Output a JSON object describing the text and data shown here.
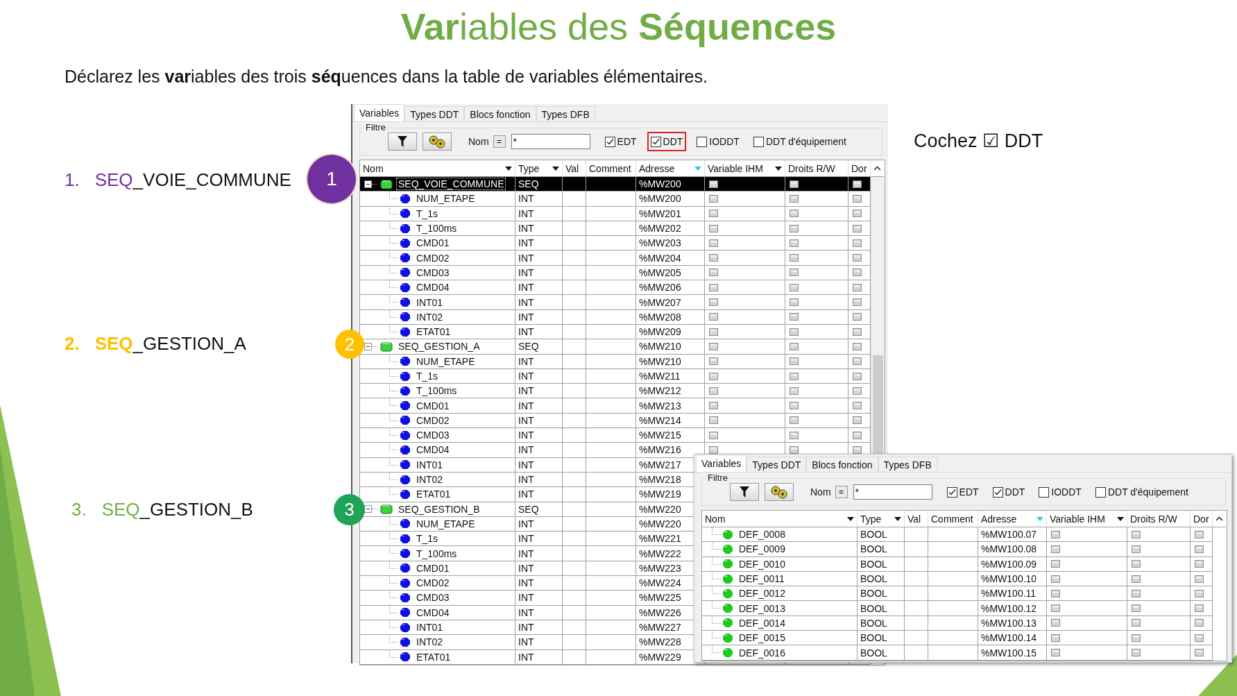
{
  "slide": {
    "title": "**Var**iables des **Séquences**",
    "instruction": "Déclarez les **var**iables des trois **séq**uences dans la table de variables élémentaires.",
    "hint": "Cochez ☑ DDT",
    "sequences": [
      {
        "number": "1.",
        "prefix": "SEQ",
        "rest": "_VOIE_COMMUNE",
        "color": "#7030a0",
        "badge": {
          "label": "1",
          "color": "#7030a0"
        }
      },
      {
        "number": "2.",
        "prefix": "SEQ",
        "rest": "_GESTION_A",
        "color": "#ffc000",
        "badge": {
          "label": "2",
          "color": "#ffc000"
        }
      },
      {
        "number": "3.",
        "prefix": "SEQ",
        "rest": "_GESTION_B",
        "color": "#70ad47",
        "badge": {
          "label": "3",
          "color": "#1ea456"
        }
      }
    ]
  },
  "windows": [
    {
      "tabs": [
        {
          "label": "Variables",
          "selected": true
        },
        {
          "label": "Types DDT",
          "selected": false
        },
        {
          "label": "Blocs fonction",
          "selected": false
        },
        {
          "label": "Types DFB",
          "selected": false
        }
      ],
      "filter": {
        "legend": "Filtre",
        "name_label": "Nom",
        "operator": "=",
        "value": "*",
        "options": [
          {
            "label": "EDT",
            "checked": true,
            "highlighted": false
          },
          {
            "label": "DDT",
            "checked": true,
            "highlighted": true
          },
          {
            "label": "IODDT",
            "checked": false,
            "highlighted": false
          },
          {
            "label": "DDT d'équipement",
            "checked": false,
            "highlighted": false
          }
        ]
      },
      "columns": [
        {
          "label": "Nom",
          "menu": true,
          "sorted": false
        },
        {
          "label": "Type",
          "menu": true,
          "sorted": false
        },
        {
          "label": "Val",
          "menu": false,
          "sorted": false
        },
        {
          "label": "Comment",
          "menu": false,
          "sorted": false
        },
        {
          "label": "Adresse",
          "menu": false,
          "sorted": true
        },
        {
          "label": "Variable IHM",
          "menu": true,
          "sorted": false
        },
        {
          "label": "Droits R/W",
          "menu": false,
          "sorted": false
        },
        {
          "label": "Dor",
          "menu": false,
          "sorted": false
        }
      ],
      "rows": [
        {
          "name": "SEQ_VOIE_COMMUNE",
          "type": "SEQ",
          "address": "%MW200",
          "kind": "sequence",
          "expanded": true,
          "selected": true,
          "children": [
            {
              "name": "NUM_ETAPE",
              "type": "INT",
              "address": "%MW200",
              "kind": "int",
              "selected": false
            },
            {
              "name": "T_1s",
              "type": "INT",
              "address": "%MW201",
              "kind": "int",
              "selected": false
            },
            {
              "name": "T_100ms",
              "type": "INT",
              "address": "%MW202",
              "kind": "int",
              "selected": false
            },
            {
              "name": "CMD01",
              "type": "INT",
              "address": "%MW203",
              "kind": "int",
              "selected": false
            },
            {
              "name": "CMD02",
              "type": "INT",
              "address": "%MW204",
              "kind": "int",
              "selected": false
            },
            {
              "name": "CMD03",
              "type": "INT",
              "address": "%MW205",
              "kind": "int",
              "selected": false
            },
            {
              "name": "CMD04",
              "type": "INT",
              "address": "%MW206",
              "kind": "int",
              "selected": false
            },
            {
              "name": "INT01",
              "type": "INT",
              "address": "%MW207",
              "kind": "int",
              "selected": false
            },
            {
              "name": "INT02",
              "type": "INT",
              "address": "%MW208",
              "kind": "int",
              "selected": false
            },
            {
              "name": "ETAT01",
              "type": "INT",
              "address": "%MW209",
              "kind": "int",
              "selected": false
            }
          ]
        },
        {
          "name": "SEQ_GESTION_A",
          "type": "SEQ",
          "address": "%MW210",
          "kind": "sequence",
          "expanded": true,
          "selected": false,
          "children": [
            {
              "name": "NUM_ETAPE",
              "type": "INT",
              "address": "%MW210",
              "kind": "int",
              "selected": false
            },
            {
              "name": "T_1s",
              "type": "INT",
              "address": "%MW211",
              "kind": "int",
              "selected": false
            },
            {
              "name": "T_100ms",
              "type": "INT",
              "address": "%MW212",
              "kind": "int",
              "selected": false
            },
            {
              "name": "CMD01",
              "type": "INT",
              "address": "%MW213",
              "kind": "int",
              "selected": false
            },
            {
              "name": "CMD02",
              "type": "INT",
              "address": "%MW214",
              "kind": "int",
              "selected": false
            },
            {
              "name": "CMD03",
              "type": "INT",
              "address": "%MW215",
              "kind": "int",
              "selected": false
            },
            {
              "name": "CMD04",
              "type": "INT",
              "address": "%MW216",
              "kind": "int",
              "selected": false
            },
            {
              "name": "INT01",
              "type": "INT",
              "address": "%MW217",
              "kind": "int",
              "selected": false
            },
            {
              "name": "INT02",
              "type": "INT",
              "address": "%MW218",
              "kind": "int",
              "selected": false
            },
            {
              "name": "ETAT01",
              "type": "INT",
              "address": "%MW219",
              "kind": "int",
              "selected": false
            }
          ]
        },
        {
          "name": "SEQ_GESTION_B",
          "type": "SEQ",
          "address": "%MW220",
          "kind": "sequence",
          "expanded": true,
          "selected": false,
          "children": [
            {
              "name": "NUM_ETAPE",
              "type": "INT",
              "address": "%MW220",
              "kind": "int",
              "selected": false
            },
            {
              "name": "T_1s",
              "type": "INT",
              "address": "%MW221",
              "kind": "int",
              "selected": false
            },
            {
              "name": "T_100ms",
              "type": "INT",
              "address": "%MW222",
              "kind": "int",
              "selected": false
            },
            {
              "name": "CMD01",
              "type": "INT",
              "address": "%MW223",
              "kind": "int",
              "selected": false
            },
            {
              "name": "CMD02",
              "type": "INT",
              "address": "%MW224",
              "kind": "int",
              "selected": false
            },
            {
              "name": "CMD03",
              "type": "INT",
              "address": "%MW225",
              "kind": "int",
              "selected": false
            },
            {
              "name": "CMD04",
              "type": "INT",
              "address": "%MW226",
              "kind": "int",
              "selected": false
            },
            {
              "name": "INT01",
              "type": "INT",
              "address": "%MW227",
              "kind": "int",
              "selected": false
            },
            {
              "name": "INT02",
              "type": "INT",
              "address": "%MW228",
              "kind": "int",
              "selected": false
            },
            {
              "name": "ETAT01",
              "type": "INT",
              "address": "%MW229",
              "kind": "int",
              "selected": false
            }
          ]
        }
      ]
    },
    {
      "tabs": [
        {
          "label": "Variables",
          "selected": true
        },
        {
          "label": "Types DDT",
          "selected": false
        },
        {
          "label": "Blocs fonction",
          "selected": false
        },
        {
          "label": "Types DFB",
          "selected": false
        }
      ],
      "filter": {
        "legend": "Filtre",
        "name_label": "Nom",
        "operator": "=",
        "value": "*",
        "options": [
          {
            "label": "EDT",
            "checked": true,
            "highlighted": false
          },
          {
            "label": "DDT",
            "checked": true,
            "highlighted": false
          },
          {
            "label": "IODDT",
            "checked": false,
            "highlighted": false
          },
          {
            "label": "DDT d'équipement",
            "checked": false,
            "highlighted": false
          }
        ]
      },
      "columns": [
        {
          "label": "Nom",
          "menu": true,
          "sorted": false
        },
        {
          "label": "Type",
          "menu": true,
          "sorted": false
        },
        {
          "label": "Val",
          "menu": false,
          "sorted": false
        },
        {
          "label": "Comment",
          "menu": false,
          "sorted": false
        },
        {
          "label": "Adresse",
          "menu": false,
          "sorted": true
        },
        {
          "label": "Variable IHM",
          "menu": true,
          "sorted": false
        },
        {
          "label": "Droits R/W",
          "menu": false,
          "sorted": false
        },
        {
          "label": "Dor",
          "menu": false,
          "sorted": false
        }
      ],
      "rows": [
        {
          "name": "DEF_0008",
          "type": "BOOL",
          "address": "%MW100.07",
          "kind": "bool",
          "selected": false
        },
        {
          "name": "DEF_0009",
          "type": "BOOL",
          "address": "%MW100.08",
          "kind": "bool",
          "selected": false
        },
        {
          "name": "DEF_0010",
          "type": "BOOL",
          "address": "%MW100.09",
          "kind": "bool",
          "selected": false
        },
        {
          "name": "DEF_0011",
          "type": "BOOL",
          "address": "%MW100.10",
          "kind": "bool",
          "selected": false
        },
        {
          "name": "DEF_0012",
          "type": "BOOL",
          "address": "%MW100.11",
          "kind": "bool",
          "selected": false
        },
        {
          "name": "DEF_0013",
          "type": "BOOL",
          "address": "%MW100.12",
          "kind": "bool",
          "selected": false
        },
        {
          "name": "DEF_0014",
          "type": "BOOL",
          "address": "%MW100.13",
          "kind": "bool",
          "selected": false
        },
        {
          "name": "DEF_0015",
          "type": "BOOL",
          "address": "%MW100.14",
          "kind": "bool",
          "selected": false
        },
        {
          "name": "DEF_0016",
          "type": "BOOL",
          "address": "%MW100.15",
          "kind": "bool",
          "selected": false
        }
      ]
    }
  ]
}
